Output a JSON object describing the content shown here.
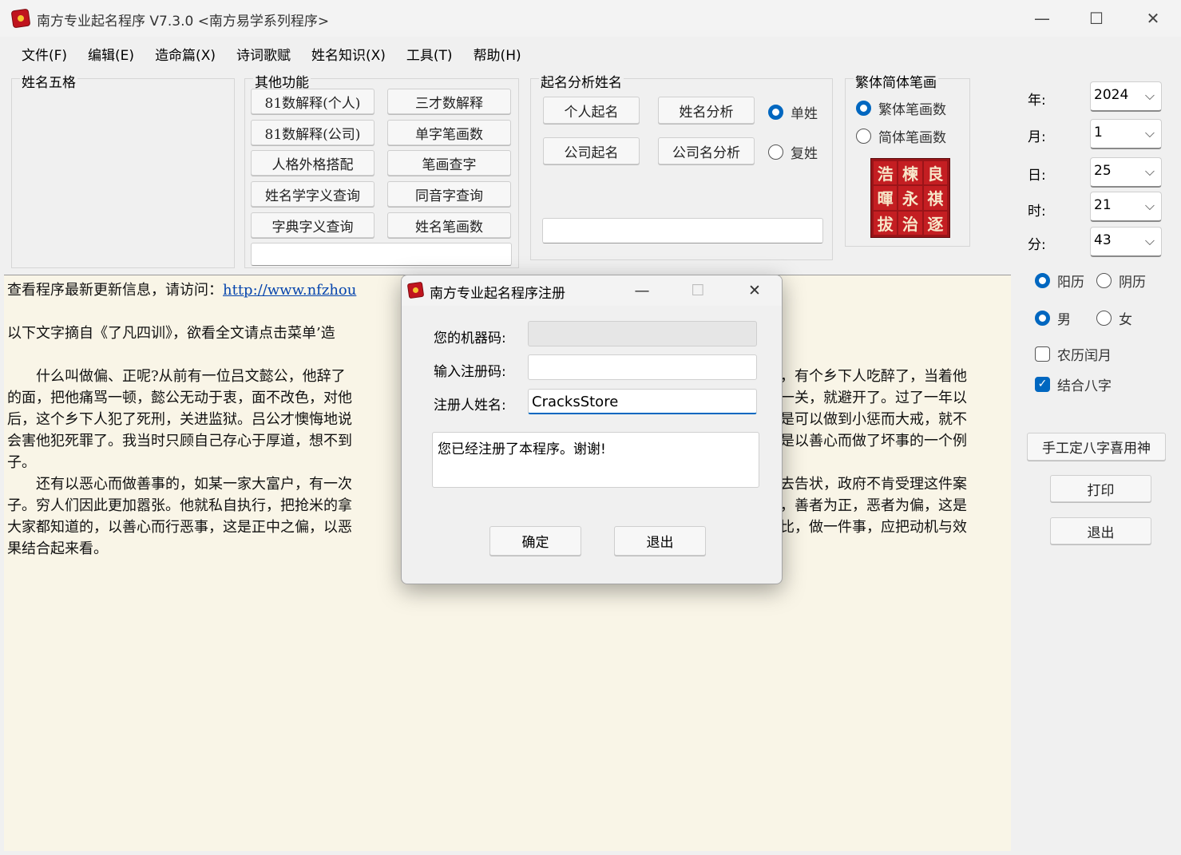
{
  "window": {
    "title": "南方专业起名程序 V7.3.0   <南方易学系列程序>",
    "minimize": "—",
    "maximize": "☐",
    "close": "✕"
  },
  "menu": [
    "文件(F)",
    "编辑(E)",
    "造命篇(X)",
    "诗词歌赋",
    "姓名知识(X)",
    "工具(T)",
    "帮助(H)"
  ],
  "panels": {
    "wuge": {
      "title": "姓名五格"
    },
    "other": {
      "title": "其他功能",
      "buttons": [
        "81数解释(个人)",
        "三才数解释",
        "81数解释(公司)",
        "单字笔画数",
        "人格外格搭配",
        "笔画查字",
        "姓名学字义查询",
        "同音字查询",
        "字典字义查询",
        "姓名笔画数"
      ]
    },
    "naming": {
      "title": "起名分析姓名",
      "buttons": [
        "个人起名",
        "姓名分析",
        "公司起名",
        "公司名分析"
      ],
      "radios": [
        {
          "label": "单姓",
          "checked": true
        },
        {
          "label": "复姓",
          "checked": false
        }
      ]
    },
    "strokes": {
      "title": "繁体简体笔画",
      "radios": [
        {
          "label": "繁体笔画数",
          "checked": true
        },
        {
          "label": "简体笔画数",
          "checked": false
        }
      ],
      "image_chars": [
        "浩",
        "楝",
        "良",
        "暉",
        "永",
        "祺",
        "拔",
        "治",
        "逐"
      ]
    }
  },
  "datetime": {
    "year_label": "年:",
    "year": "2024",
    "month_label": "月:",
    "month": "1",
    "day_label": "日:",
    "day": "25",
    "hour_label": "时:",
    "hour": "21",
    "minute_label": "分:",
    "minute": "43",
    "calendar": [
      {
        "label": "阳历",
        "checked": true
      },
      {
        "label": "阴历",
        "checked": false
      }
    ],
    "gender": [
      {
        "label": "男",
        "checked": true
      },
      {
        "label": "女",
        "checked": false
      }
    ],
    "leap_month": {
      "label": "农历闰月",
      "checked": false
    },
    "bazi": {
      "label": "结合八字",
      "checked": true
    }
  },
  "side_buttons": {
    "manual": "手工定八字喜用神",
    "print": "打印",
    "exit": "退出"
  },
  "content": {
    "line1_prefix": "查看程序最新更新信息，请访问：",
    "line1_link": "http://www.nfzhou",
    "line2": "以下文字摘自《了凡四训》，欲看全文请点击菜单’造",
    "p1_left": [
      "什么叫做偏、正呢?从前有一位吕文懿公，他辞了",
      "的面，把他痛骂一顿，懿公无动于衷，面不改色，对他",
      "后，这个乡下人犯了死刑，关进监狱。吕公才懊悔地说",
      "会害他犯死罪了。我当时只顾自己存心于厚道，想不到",
      "子。"
    ],
    "p1_right": [
      "，有个乡下人吃醉了，当着他",
      "一关，就避开了。过了一年以",
      "是可以做到小惩而大戒，就不",
      "是以善心而做了坏事的一个例",
      ""
    ],
    "p2_left": [
      "还有以恶心而做善事的，如某一家大富户，有一次",
      "子。穷人们因此更加嚣张。他就私自执行，把抢米的拿",
      "大家都知道的，以善心而行恶事，这是正中之偏，以恶",
      "果结合起来看。"
    ],
    "p2_right": [
      "去告状，政府不肯受理这件案",
      "，善者为正，恶者为偏，这是",
      "比，做一件事，应把动机与效",
      ""
    ]
  },
  "dialog": {
    "title": "南方专业起名程序注册",
    "minimize": "—",
    "maximize": "☐",
    "close": "✕",
    "machine_label": "您的机器码:",
    "machine_value": "",
    "code_label": "输入注册码:",
    "code_value": "",
    "name_label": "注册人姓名:",
    "name_value": "CracksStore",
    "message": "您已经注册了本程序。谢谢!",
    "ok": "确定",
    "exit": "退出"
  }
}
